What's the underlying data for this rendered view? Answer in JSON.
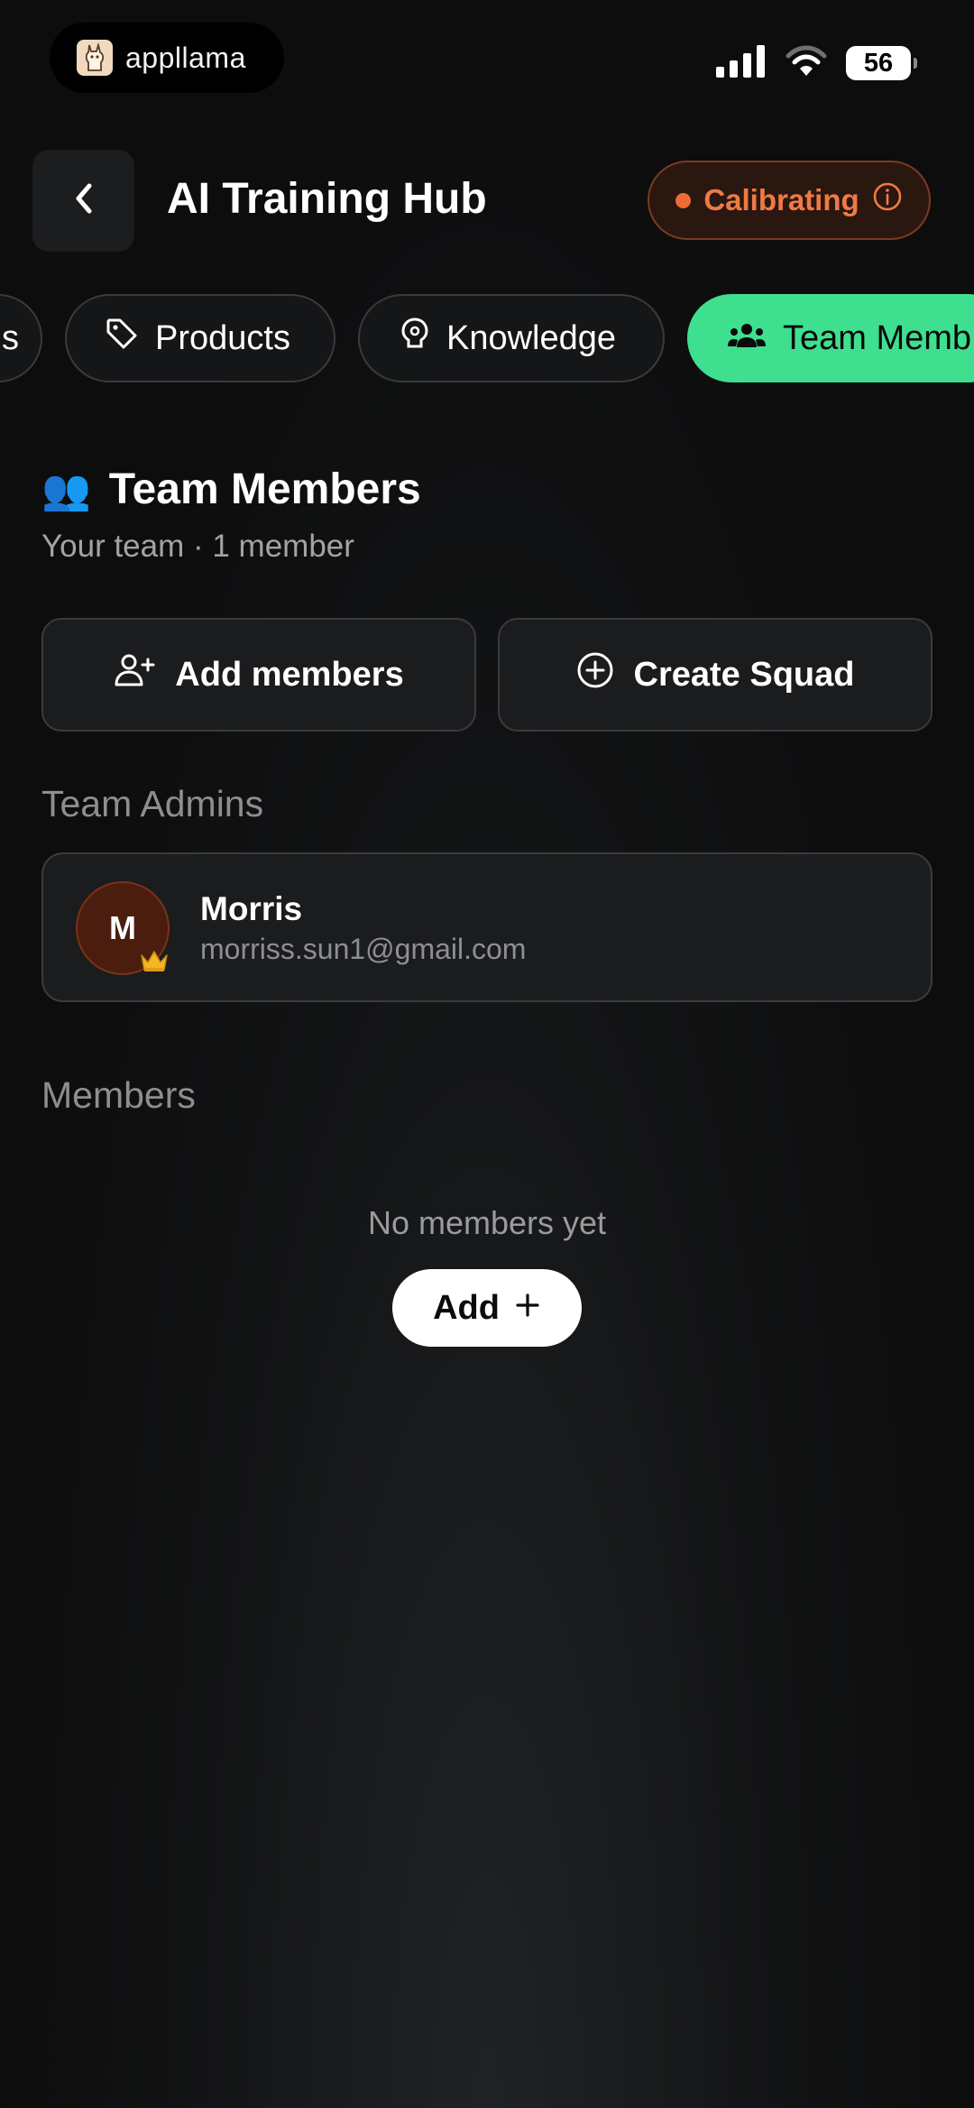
{
  "status_bar": {
    "brand_name": "appllama",
    "battery_level": "56"
  },
  "header": {
    "title": "AI Training Hub",
    "status_label": "Calibrating",
    "status_color": "#ef7a45"
  },
  "tabs": [
    {
      "label": "s",
      "icon": "partial-tab",
      "active": false
    },
    {
      "label": "Products",
      "icon": "tag-icon",
      "active": false
    },
    {
      "label": "Knowledge",
      "icon": "brain-bulb-icon",
      "active": false
    },
    {
      "label": "Team Memb",
      "icon": "team-icon",
      "active": true
    }
  ],
  "section": {
    "emoji": "👥",
    "title": "Team Members",
    "subtitle": "Your team · 1 member"
  },
  "actions": {
    "add_members_label": "Add members",
    "create_squad_label": "Create Squad"
  },
  "admins": {
    "label": "Team Admins",
    "items": [
      {
        "initial": "M",
        "name": "Morris",
        "email": "morriss.sun1@gmail.com",
        "badge": "crown-icon"
      }
    ]
  },
  "members": {
    "label": "Members",
    "empty_text": "No members yet",
    "add_label": "Add"
  },
  "colors": {
    "accent_green": "#3ee08f",
    "warning_orange": "#ef7a45",
    "background": "#0e0e0f"
  }
}
